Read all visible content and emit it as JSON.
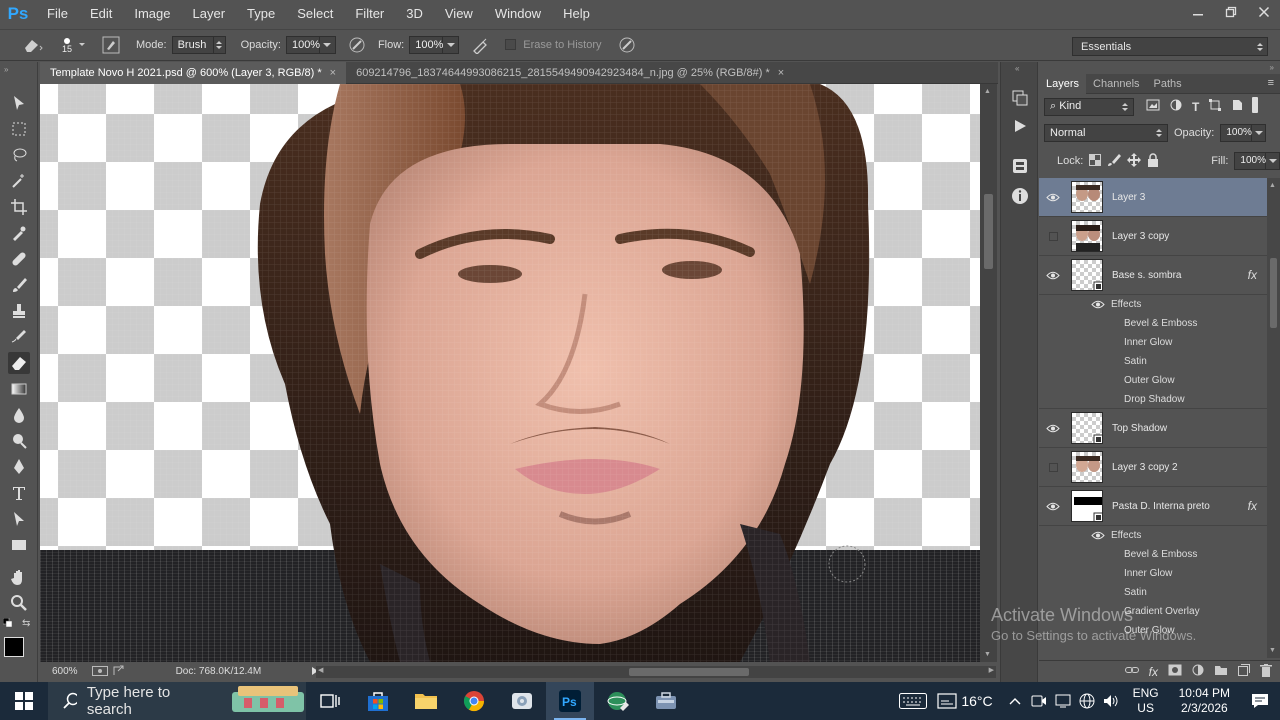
{
  "app": {
    "logo": "Ps"
  },
  "menu": [
    "File",
    "Edit",
    "Image",
    "Layer",
    "Type",
    "Select",
    "Filter",
    "3D",
    "View",
    "Window",
    "Help"
  ],
  "options": {
    "brush_size": "15",
    "mode_label": "Mode:",
    "mode_value": "Brush",
    "opacity_label": "Opacity:",
    "opacity_value": "100%",
    "flow_label": "Flow:",
    "flow_value": "100%",
    "erase_history_label": "Erase to History",
    "workspace": "Essentials"
  },
  "tabs": [
    {
      "label": "Template Novo H 2021.psd @ 600% (Layer 3, RGB/8) *",
      "close": "×"
    },
    {
      "label": "609214796_18374644993086215_2815549490942923484_n.jpg @ 25% (RGB/8#) *",
      "close": "×"
    }
  ],
  "status": {
    "zoom": "600%",
    "doc": "Doc: 768.0K/12.4M"
  },
  "layers_panel": {
    "tabs": [
      "Layers",
      "Channels",
      "Paths"
    ],
    "filter_kind": "Kind",
    "blend_mode": "Normal",
    "opacity_label": "Opacity:",
    "opacity_value": "100%",
    "lock_label": "Lock:",
    "fill_label": "Fill:",
    "fill_value": "100%",
    "effects_label": "Effects",
    "layers": [
      {
        "name": "Layer 3",
        "visible": true,
        "selected": true,
        "fx": ""
      },
      {
        "name": "Layer 3 copy",
        "visible": false,
        "selected": false,
        "fx": ""
      },
      {
        "name": "Base s. sombra",
        "visible": true,
        "selected": false,
        "fx": "fx",
        "effects": [
          "Bevel & Emboss",
          "Inner Glow",
          "Satin",
          "Outer Glow",
          "Drop Shadow"
        ]
      },
      {
        "name": "Top Shadow",
        "visible": true,
        "selected": false,
        "fx": ""
      },
      {
        "name": "Layer 3 copy 2",
        "visible": false,
        "selected": false,
        "fx": ""
      },
      {
        "name": "Pasta D. Interna preto",
        "visible": true,
        "selected": false,
        "fx": "fx",
        "effects": [
          "Bevel & Emboss",
          "Inner Glow",
          "Satin",
          "Gradient Overlay",
          "Outer Glow"
        ]
      }
    ]
  },
  "watermark": {
    "line1": "Activate Windows",
    "line2": "Go to Settings to activate Windows."
  },
  "taskbar": {
    "search_placeholder": "Type here to search",
    "temperature": "16°C",
    "language": "ENG",
    "region": "US",
    "time": "10:04 PM",
    "date": "2/3/2026"
  },
  "colors": {
    "accent": "#31a8ff",
    "selected_layer": "#6e7c93",
    "panel_bg": "#535353"
  }
}
